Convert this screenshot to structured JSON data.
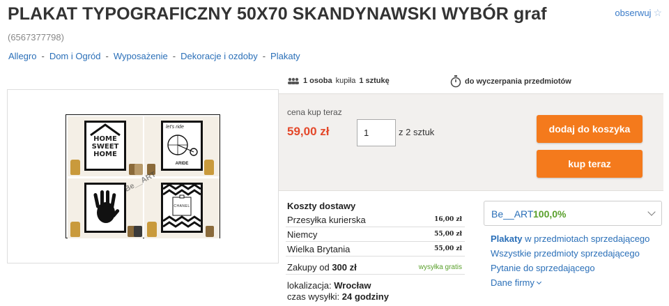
{
  "header": {
    "title": "PLAKAT TYPOGRAFICZNY 50X70 SKANDYNAWSKI WYBÓR graf",
    "watch_label": "obserwuj",
    "item_id": "(6567377798)"
  },
  "breadcrumb": [
    "Allegro",
    "Dom i Ogród",
    "Wyposażenie",
    "Dekoracje i ozdoby",
    "Plakaty"
  ],
  "gallery": {
    "poster_home_text": "HOME\nSWEET\nHOME",
    "poster_bike_text": "let's ride",
    "poster_bike_sub": "ARIDE",
    "poster_chanel_text": "CHANEL",
    "watermark": "Be__ART"
  },
  "stats": {
    "buyers_count": "1 osoba",
    "bought_word": "kupiła",
    "units": "1 sztukę",
    "until_label": "do wyczerpania przedmiotów"
  },
  "buy": {
    "price_label": "cena kup teraz",
    "price": "59,00 zł",
    "quantity": "1",
    "of_units": "z 2 sztuk",
    "add_to_cart": "dodaj do koszyka",
    "buy_now": "kup teraz"
  },
  "shipping": {
    "title": "Koszty dostawy",
    "rows": [
      {
        "name": "Przesyłka kurierska",
        "price": "16,00 zł"
      },
      {
        "name": "Niemcy",
        "price": "55,00 zł"
      },
      {
        "name": "Wielka Brytania",
        "price": "55,00 zł"
      }
    ],
    "free_label_prefix": "Zakupy od",
    "free_threshold": "300 zł",
    "free_label": "wysyłka gratis",
    "location_label": "lokalizacja:",
    "location": "Wrocław",
    "dispatch_label": "czas wysyłki:",
    "dispatch": "24 godziny"
  },
  "seller": {
    "name": "Be__ART",
    "rating": "100,0%",
    "links": {
      "category": "Plakaty",
      "category_suffix": "w przedmiotach sprzedającego",
      "all_items": "Wszystkie przedmioty sprzedającego",
      "ask": "Pytanie do sprzedającego",
      "company": "Dane firmy"
    }
  },
  "colors": {
    "accent_orange": "#f47a1c",
    "price_red": "#e4482a",
    "link_blue": "#2a6fb8",
    "rating_green": "#5aa02c"
  }
}
